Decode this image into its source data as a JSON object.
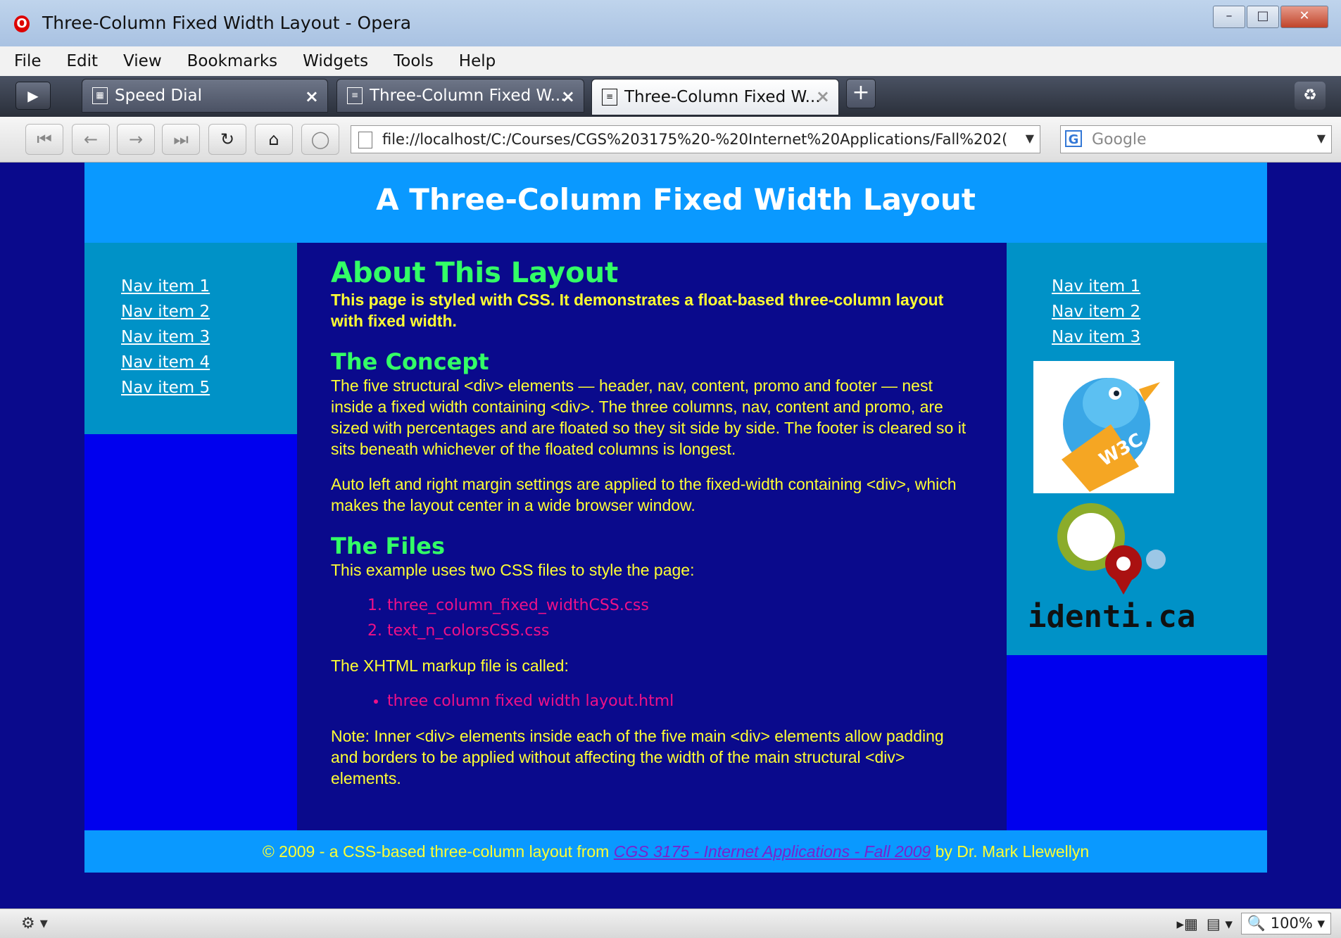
{
  "window": {
    "title": "Three-Column Fixed Width Layout - Opera"
  },
  "menu": [
    "File",
    "Edit",
    "View",
    "Bookmarks",
    "Widgets",
    "Tools",
    "Help"
  ],
  "tabs": [
    {
      "label": "Speed Dial"
    },
    {
      "label": "Three-Column Fixed W..."
    },
    {
      "label": "Three-Column Fixed W..."
    }
  ],
  "address": {
    "url": "file://localhost/C:/Courses/CGS%203175%20-%20Internet%20Applications/Fall%202(",
    "search_placeholder": "Google"
  },
  "page": {
    "header_title": "A Three-Column Fixed Width Layout",
    "nav_left": [
      "Nav item 1",
      "Nav item 2",
      "Nav item 3",
      "Nav item 4",
      "Nav item 5"
    ],
    "nav_right": [
      "Nav item 1",
      "Nav item 2",
      "Nav item 3"
    ],
    "about_title": "About This Layout",
    "about_intro": "This page is styled with CSS. It demonstrates a float-based three-column layout with fixed width.",
    "concept_title": "The Concept",
    "concept_p1": "The five structural <div> elements — header, nav, content, promo and footer — nest inside a fixed width containing <div>. The three columns, nav, content and promo, are sized with percentages and are floated so they sit side by side. The footer is cleared so it sits beneath whichever of the floated columns is longest.",
    "concept_p2": "Auto left and right margin settings are applied to the fixed-width containing <div>, which makes the layout center in a wide browser window.",
    "files_title": "The Files",
    "files_intro": "This example uses two CSS files to style the page:",
    "css_files": [
      "three_column_fixed_widthCSS.css",
      "text_n_colorsCSS.css"
    ],
    "markup_intro": "The XHTML markup file is called:",
    "markup_files": [
      "three column fixed width layout.html"
    ],
    "note": "Note: Inner <div> elements inside each of the five main <div> elements allow padding and borders to be applied without affecting the width of the main structural <div> elements.",
    "promo_badge": "W3C",
    "promo_logo_text": "identi.ca",
    "footer_prefix": "© 2009 - a CSS-based three-column layout from ",
    "footer_link": "CGS 3175 - Internet Applications - Fall 2009",
    "footer_suffix": " by Dr. Mark Llewellyn"
  },
  "status": {
    "zoom": "100%"
  }
}
